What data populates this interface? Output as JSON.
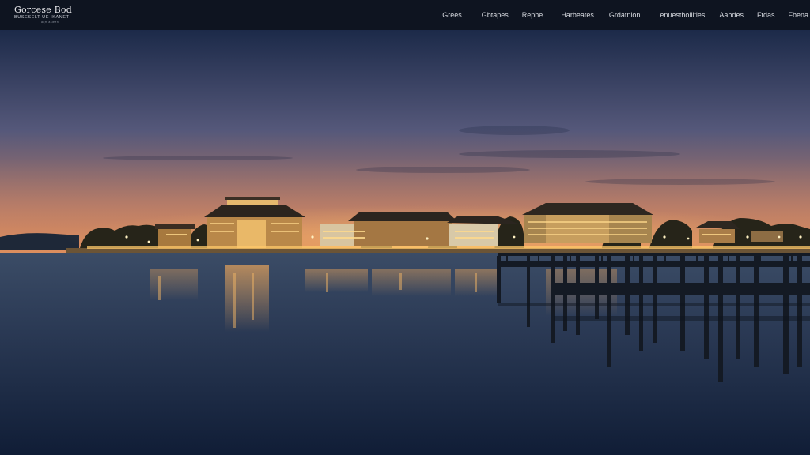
{
  "site": {
    "brand_name": "Gorcese Bod",
    "brand_tagline": "Buseselt ue ikanet",
    "brand_sub": "aqm asleen"
  },
  "nav": {
    "items": [
      {
        "label": "Grees"
      },
      {
        "label": "Gbtapes"
      },
      {
        "label": "Rephe"
      },
      {
        "label": "Harbeates"
      },
      {
        "label": "Grdatnion"
      },
      {
        "label": "Lenuesthoilities"
      },
      {
        "label": "Aabdes"
      },
      {
        "label": "Ftdas"
      },
      {
        "label": "Fbena"
      }
    ]
  },
  "hero": {
    "scene": "waterfront-night-photo",
    "colors": {
      "sky_top": "#1c2a49",
      "sky_mid": "#55587a",
      "horizon_glow": "#d7875a",
      "water_top": "#3b4c66",
      "water_bottom": "#101d36",
      "lights": "#ffc86a"
    }
  }
}
